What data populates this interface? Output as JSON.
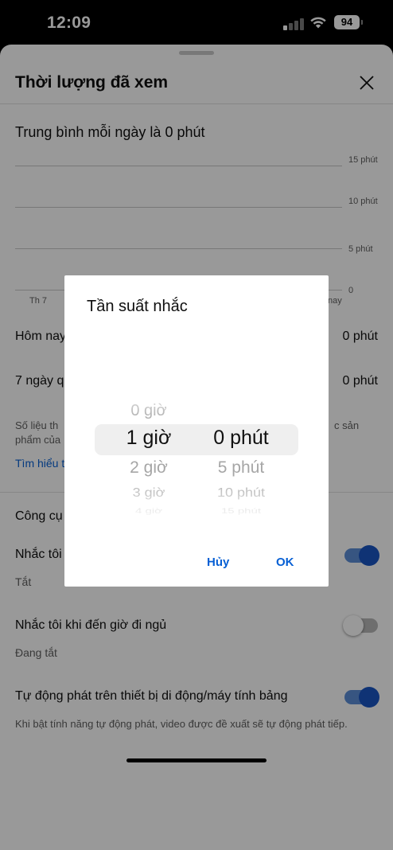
{
  "status_bar": {
    "time": "12:09",
    "battery": "94"
  },
  "sheet": {
    "title": "Thời lượng đã xem",
    "average_text": "Trung bình mỗi ngày là 0 phút",
    "chart": {
      "y_ticks": [
        "15 phút",
        "10 phút",
        "5 phút",
        "0"
      ],
      "x_ticks": [
        "Th 7",
        "nay"
      ]
    },
    "rows": [
      {
        "label": "Hôm nay",
        "value": "0 phút"
      },
      {
        "label": "7 ngày q",
        "value": "0 phút"
      }
    ],
    "note_line1": "Số liệu th",
    "note_line1_right": "c sản",
    "note_line2": "phẩm của",
    "learn_more": "Tìm hiểu t",
    "tools_title": "Công cụ",
    "reminder_label": "Nhắc tôi",
    "reminder_status": "Tắt",
    "bedtime_label": "Nhắc tôi khi đến giờ đi ngủ",
    "bedtime_status": "Đang tắt",
    "autoplay_label": "Tự động phát trên thiết bị di động/máy tính bảng",
    "autoplay_desc": "Khi bật tính năng tự động phát, video được đề xuất sẽ tự động phát tiếp."
  },
  "dialog": {
    "title": "Tần suất nhắc",
    "hours": [
      "0 giờ",
      "1 giờ",
      "2 giờ",
      "3 giờ",
      "4 giờ"
    ],
    "minutes": [
      "0 phút",
      "5 phút",
      "10 phút",
      "15 phút"
    ],
    "selected_hour": "1 giờ",
    "selected_minute": "0 phút",
    "cancel_label": "Hủy",
    "ok_label": "OK"
  },
  "colors": {
    "accent": "#065fd4",
    "toggle_on": "#1a56c4"
  },
  "toggles": {
    "reminder": true,
    "bedtime": false,
    "autoplay": true
  }
}
